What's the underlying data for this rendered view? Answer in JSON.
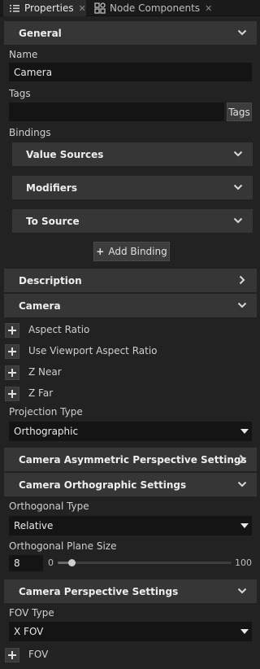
{
  "tabs": [
    {
      "label": "Properties",
      "icon": "list-icon",
      "active": true
    },
    {
      "label": "Node Components",
      "icon": "components-icon",
      "active": false
    }
  ],
  "general": {
    "title": "General",
    "name_label": "Name",
    "name_value": "Camera",
    "tags_label": "Tags",
    "tags_value": "",
    "tags_button": "Tags",
    "bindings_label": "Bindings",
    "value_sources": "Value Sources",
    "modifiers": "Modifiers",
    "to_source": "To Source",
    "add_binding": "Add Binding"
  },
  "description": {
    "title": "Description"
  },
  "camera": {
    "title": "Camera",
    "properties": [
      "Aspect Ratio",
      "Use Viewport Aspect Ratio",
      "Z Near",
      "Z Far"
    ],
    "projection_type_label": "Projection Type",
    "projection_type_value": "Orthographic"
  },
  "asymmetric": {
    "title": "Camera Asymmetric Perspective Settings"
  },
  "orthographic": {
    "title": "Camera Orthographic Settings",
    "orthogonal_type_label": "Orthogonal Type",
    "orthogonal_type_value": "Relative",
    "plane_size_label": "Orthogonal Plane Size",
    "plane_size_value": "8",
    "slider_min": "0",
    "slider_max": "100",
    "slider_fraction": 0.08
  },
  "perspective": {
    "title": "Camera Perspective Settings",
    "fov_type_label": "FOV Type",
    "fov_type_value": "X FOV",
    "fov_label": "FOV"
  },
  "colors": {
    "background": "#222222",
    "section": "#363636",
    "field": "#141414"
  }
}
